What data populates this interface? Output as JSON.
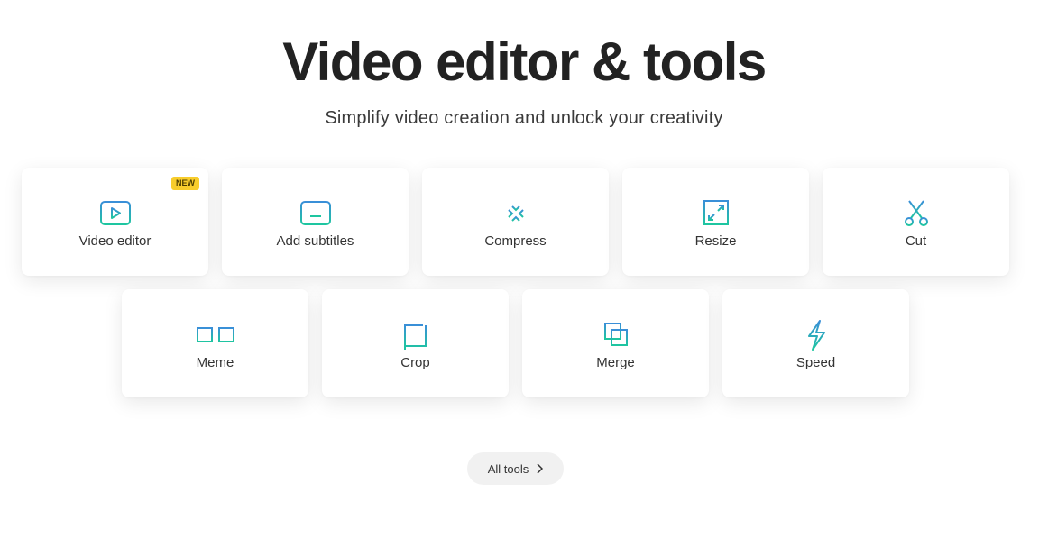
{
  "header": {
    "title": "Video editor & tools",
    "subtitle": "Simplify video creation and unlock your creativity"
  },
  "colors": {
    "icon_gradient_top": "#3a8fd8",
    "icon_gradient_bottom": "#1ec6a0",
    "badge_bg": "#f8cd2c",
    "button_bg": "#f1f1f1"
  },
  "tools": [
    {
      "label": "Video editor",
      "icon": "play-icon",
      "badge": "NEW"
    },
    {
      "label": "Add subtitles",
      "icon": "subtitles-icon"
    },
    {
      "label": "Compress",
      "icon": "compress-icon"
    },
    {
      "label": "Resize",
      "icon": "resize-icon"
    },
    {
      "label": "Cut",
      "icon": "scissors-icon"
    },
    {
      "label": "Meme",
      "icon": "glasses-icon"
    },
    {
      "label": "Crop",
      "icon": "crop-icon"
    },
    {
      "label": "Merge",
      "icon": "merge-icon"
    },
    {
      "label": "Speed",
      "icon": "lightning-icon"
    }
  ],
  "all_tools_button": {
    "label": "All tools",
    "icon": "chevron-right-icon"
  }
}
